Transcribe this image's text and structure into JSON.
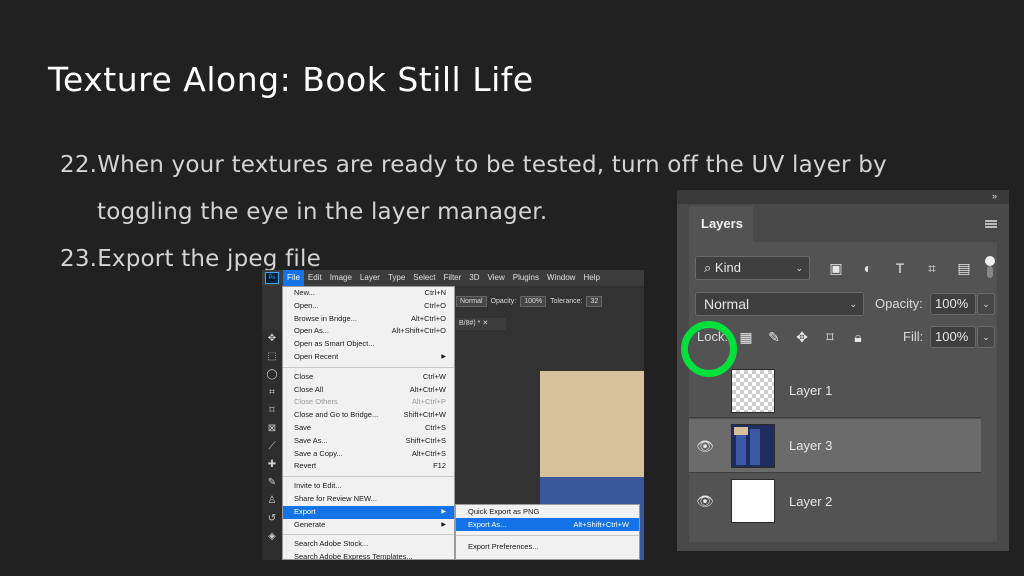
{
  "slide": {
    "title": "Texture Along: Book Still Life",
    "step22_num": "22.",
    "step22_line1": "When your textures are ready to be tested, turn off the UV layer by",
    "step22_line2": "toggling the eye in the layer manager.",
    "step23_num": "23.",
    "step23_text": "Export the jpeg file"
  },
  "photoshop": {
    "logo": "Ps",
    "menubar": [
      "File",
      "Edit",
      "Image",
      "Layer",
      "Type",
      "Select",
      "Filter",
      "3D",
      "View",
      "Plugins",
      "Window",
      "Help"
    ],
    "options": {
      "mode": "Normal",
      "opacity_label": "Opacity:",
      "opacity": "100%",
      "tolerance_label": "Tolerance:",
      "tolerance": "32"
    },
    "doc_tab": "B/8#) *",
    "file_menu": [
      {
        "label": "New...",
        "shortcut": "Ctrl+N"
      },
      {
        "label": "Open...",
        "shortcut": "Ctrl+O"
      },
      {
        "label": "Browse in Bridge...",
        "shortcut": "Alt+Ctrl+O"
      },
      {
        "label": "Open As...",
        "shortcut": "Alt+Shift+Ctrl+O"
      },
      {
        "label": "Open as Smart Object...",
        "shortcut": ""
      },
      {
        "label": "Open Recent",
        "shortcut": "",
        "submenu": true
      },
      {
        "sep": true
      },
      {
        "label": "Close",
        "shortcut": "Ctrl+W"
      },
      {
        "label": "Close All",
        "shortcut": "Alt+Ctrl+W"
      },
      {
        "label": "Close Others",
        "shortcut": "Alt+Ctrl+P",
        "disabled": true
      },
      {
        "label": "Close and Go to Bridge...",
        "shortcut": "Shift+Ctrl+W"
      },
      {
        "label": "Save",
        "shortcut": "Ctrl+S"
      },
      {
        "label": "Save As...",
        "shortcut": "Shift+Ctrl+S"
      },
      {
        "label": "Save a Copy...",
        "shortcut": "Alt+Ctrl+S"
      },
      {
        "label": "Revert",
        "shortcut": "F12"
      },
      {
        "sep": true
      },
      {
        "label": "Invite to Edit...",
        "shortcut": ""
      },
      {
        "label": "Share for Review NEW...",
        "shortcut": ""
      },
      {
        "label": "Export",
        "shortcut": "",
        "submenu": true,
        "highlighted": true
      },
      {
        "label": "Generate",
        "shortcut": "",
        "submenu": true
      },
      {
        "sep": true
      },
      {
        "label": "Search Adobe Stock...",
        "shortcut": ""
      },
      {
        "label": "Search Adobe Express Templates...",
        "shortcut": ""
      }
    ],
    "export_submenu": {
      "quick_export": "Quick Export as PNG",
      "export_as": "Export As...",
      "export_as_shortcut": "Alt+Shift+Ctrl+W",
      "export_prefs": "Export Preferences..."
    },
    "canvas_colors": {
      "top": "#d6c19c",
      "bottom": "#3a5899"
    }
  },
  "layers_panel": {
    "title": "Layers",
    "kind_label": "Kind",
    "blend_mode": "Normal",
    "opacity_label": "Opacity:",
    "opacity": "100%",
    "lock_label": "Lock:",
    "fill_label": "Fill:",
    "fill": "100%",
    "layers": [
      {
        "name": "Layer 1",
        "visible": false,
        "thumb": "transparent"
      },
      {
        "name": "Layer 3",
        "visible": true,
        "thumb": "book",
        "selected": true
      },
      {
        "name": "Layer 2",
        "visible": true,
        "thumb": "white"
      }
    ],
    "highlight_color": "#00e03a"
  }
}
